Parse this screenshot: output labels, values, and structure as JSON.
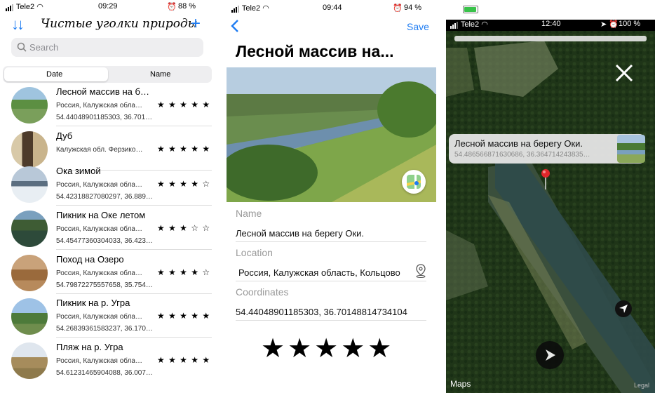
{
  "screen1": {
    "status": {
      "carrier": "Tele2",
      "time": "09:29",
      "battery": "88 %"
    },
    "title": "Чистые уголки природы",
    "sort_icon": "sort-arrows-icon",
    "add_icon": "plus-icon",
    "search_placeholder": "Search",
    "segments": [
      "Date",
      "Name"
    ],
    "items": [
      {
        "name": "Лесной массив на б…",
        "location": "Россия, Калужская обла…",
        "coords": "54.44048901185303, 36.701…",
        "stars": "★ ★ ★ ★ ★"
      },
      {
        "name": "Дуб",
        "location": "Калужская обл. Ферзико…",
        "coords": "",
        "stars": "★ ★ ★ ★ ★"
      },
      {
        "name": "Ока зимой",
        "location": "Россия, Калужская обла…",
        "coords": "54.42318827080297, 36.889…",
        "stars": "★ ★ ★ ★ ☆"
      },
      {
        "name": "Пикник на Оке летом",
        "location": "Россия, Калужская обла…",
        "coords": "54.45477360304033, 36.423…",
        "stars": "★ ★ ★ ☆ ☆"
      },
      {
        "name": "Поход на Озеро",
        "location": "Россия, Калужская обла…",
        "coords": "54.79872275557658, 35.7542…",
        "stars": "★ ★ ★ ★ ☆"
      },
      {
        "name": "Пикник на р. Угра",
        "location": "Россия, Калужская обла…",
        "coords": "54.26839361583237, 36.170…",
        "stars": "★ ★ ★ ★ ★"
      },
      {
        "name": "Пляж на р. Угра",
        "location": "Россия, Калужская обла…",
        "coords": "54.61231465904088, 36.007…",
        "stars": "★ ★ ★ ★ ★"
      }
    ]
  },
  "screen2": {
    "status": {
      "carrier": "Tele2",
      "time": "09:44",
      "battery": "94 %"
    },
    "back_icon": "chevron-left-icon",
    "save_label": "Save",
    "title": "Лесной массив на...",
    "name_label": "Name",
    "name_value": "Лесной массив на берегу Оки.",
    "location_label": "Location",
    "location_value": "Россия, Калужская область, Кольцово",
    "coordinates_label": "Coordinates",
    "coordinates_value": "54.44048901185303, 36.70148814734104",
    "rating_stars": "★★★★★"
  },
  "screen3": {
    "status": {
      "carrier": "Tele2",
      "time": "12:40",
      "battery": "100 %"
    },
    "callout_title": "Лесной массив на берегу Оки.",
    "callout_coords": "54.486566871630686, 36.364714243835…",
    "maps_label": "Maps",
    "legal_label": "Legal"
  },
  "colors": {
    "accent": "#1e7cf2",
    "battery_green": "#39c24a",
    "pin_red": "#e1262b"
  }
}
